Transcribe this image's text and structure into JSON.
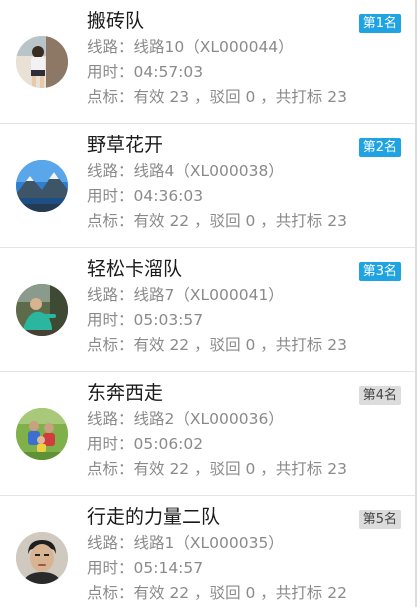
{
  "labels": {
    "route_prefix": "线路：",
    "time_prefix": "用时：",
    "marks_prefix": "点标："
  },
  "teams": [
    {
      "name": "搬砖队",
      "rank": "第1名",
      "rank_style": "top",
      "avatar_icon": "person-photo-avatar",
      "route": "线路10（XL000044）",
      "time": "04:57:03",
      "marks": "有效 23 ，驳回 0 ，共打标 23"
    },
    {
      "name": "野草花开",
      "rank": "第2名",
      "rank_style": "top",
      "avatar_icon": "mountain-lake-avatar",
      "route": "线路4（XL000038）",
      "time": "04:36:03",
      "marks": "有效 22 ，驳回 0 ，共打标 23"
    },
    {
      "name": "轻松卡溜队",
      "rank": "第3名",
      "rank_style": "top",
      "avatar_icon": "outdoor-person-avatar",
      "route": "线路7（XL000041）",
      "time": "05:03:57",
      "marks": "有效 22 ，驳回 0 ，共打标 23"
    },
    {
      "name": "东奔西走",
      "rank": "第4名",
      "rank_style": "other",
      "avatar_icon": "family-grass-avatar",
      "route": "线路2（XL000036）",
      "time": "05:06:02",
      "marks": "有效 22 ，驳回 0 ，共打标 23"
    },
    {
      "name": "行走的力量二队",
      "rank": "第5名",
      "rank_style": "other",
      "avatar_icon": "face-portrait-avatar",
      "route": "线路1（XL000035）",
      "time": "05:14:57",
      "marks": "有效 22 ，驳回 0 ，共打标 22"
    }
  ],
  "colors": {
    "rank_top_bg": "#1fa3e3",
    "rank_other_bg": "#dcdcdc",
    "secondary_text": "#8a8a8a"
  }
}
